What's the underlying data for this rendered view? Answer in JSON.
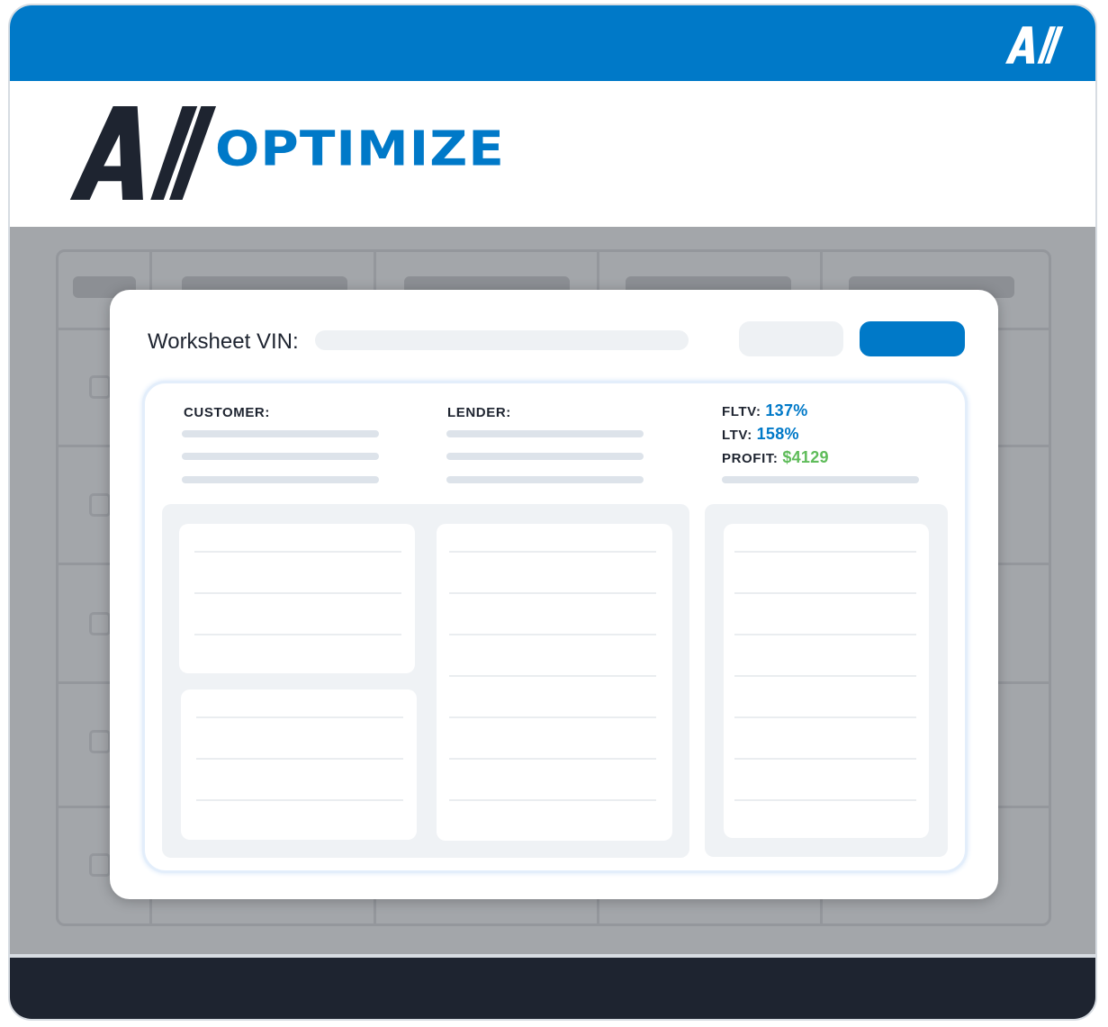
{
  "brand": {
    "product_name": "OPTIMIZE",
    "blue": "#0079c8",
    "dark": "#1e2430",
    "green": "#5fbc5a"
  },
  "worksheet": {
    "vin_label": "Worksheet VIN:",
    "customer_label": "CUSTOMER:",
    "lender_label": "LENDER:",
    "metrics": [
      {
        "label": "FLTV:",
        "value": "137%",
        "color": "blue"
      },
      {
        "label": "LTV:",
        "value": "158%",
        "color": "blue"
      },
      {
        "label": "PROFIT:",
        "value": "$4129",
        "color": "green"
      }
    ]
  },
  "icons": [
    "av-logo-icon"
  ]
}
